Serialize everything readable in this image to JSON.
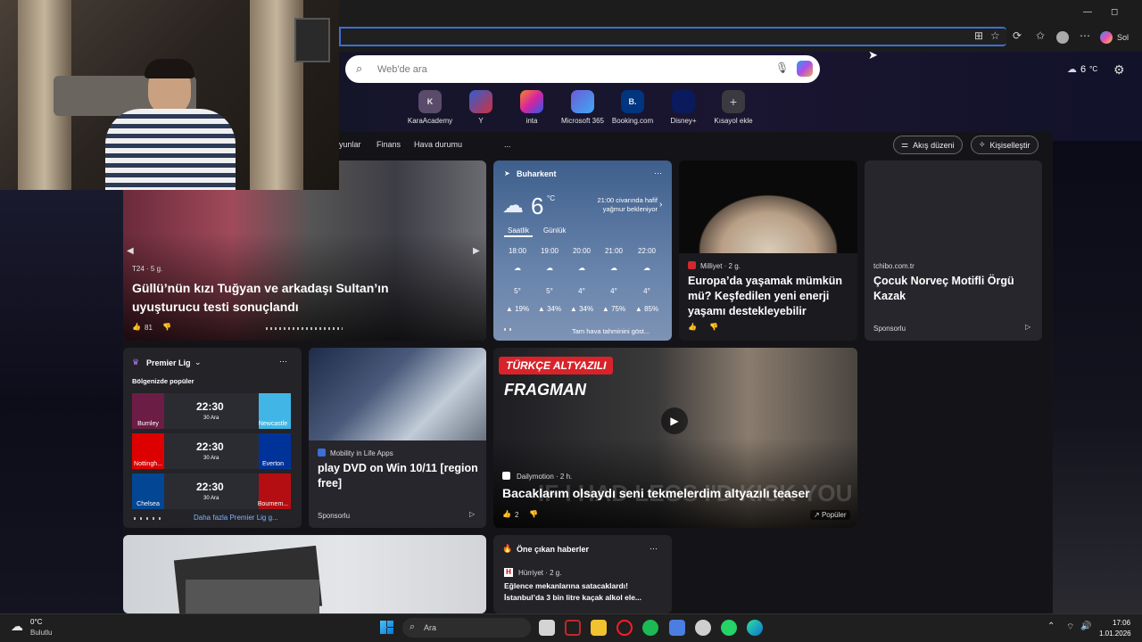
{
  "browser": {
    "profile_label": "Sol",
    "window_buttons": [
      "—",
      "◻"
    ]
  },
  "ntp": {
    "search_placeholder": "Web'de ara",
    "weather_temp": "6",
    "weather_unit": "°C",
    "quick_links": [
      {
        "label": "KaraAcademy",
        "initial": "K",
        "color": "#5a4b6a"
      },
      {
        "label": "Y",
        "initial": "",
        "color": "#2f5fd0"
      },
      {
        "label": "inta",
        "initial": "",
        "color": "#d6249f"
      },
      {
        "label": "Microsoft 365",
        "initial": "",
        "color": "#6b5bd6"
      },
      {
        "label": "Booking.com",
        "initial": "B.",
        "color": "#003580"
      },
      {
        "label": "Disney+",
        "initial": "",
        "color": "#0a1a5c"
      },
      {
        "label": "Kısayol ekle",
        "initial": "+",
        "color": "#3a3a40"
      }
    ],
    "nav": [
      "yunlar",
      "Finans",
      "Hava durumu",
      "..."
    ],
    "feed_layout_label": "Akış düzeni",
    "personalize_label": "Kişiselleştir"
  },
  "cards": {
    "hero": {
      "source": "T24 · 5 g.",
      "title": "Güllü’nün kızı Tuğyan ve arkadaşı Sultan’ın uyuşturucu testi sonuçlandı",
      "likes": "81"
    },
    "weather": {
      "location": "Buharkent",
      "temp": "6",
      "unit": "°C",
      "forecast_note": "21:00 civarında hafif yağmur bekleniyor",
      "tab_hourly": "Saatlik",
      "tab_daily": "Günlük",
      "hours": [
        "18:00",
        "19:00",
        "20:00",
        "21:00",
        "22:00"
      ],
      "temps": [
        "5°",
        "5°",
        "4°",
        "4°",
        "4°"
      ],
      "precip": [
        "19%",
        "34%",
        "34%",
        "75%",
        "85%"
      ],
      "full_link": "Tam hava tahminini göst..."
    },
    "europa": {
      "source": "Milliyet · 2 g.",
      "title": "Europa’da yaşamak mümkün mü? Keşfedilen yeni enerji yaşamı destekleyebilir"
    },
    "tchibo": {
      "source": "tchibo.com.tr",
      "title": "Çocuk Norveç Motifli Örgü Kazak",
      "sponsored": "Sponsorlu"
    },
    "league": {
      "title": "Premier Lig",
      "subtitle": "Bölgenizde popüler",
      "more": "Daha fazla Premier Lig g...",
      "matches": [
        {
          "home": "Burnley",
          "away": "Newcastle",
          "time": "22:30",
          "date": "30 Ara",
          "home_color": "#6c1d45",
          "away_color": "#41b6e6"
        },
        {
          "home": "Nottingh...",
          "away": "Everton",
          "time": "22:30",
          "date": "30 Ara",
          "home_color": "#dd0000",
          "away_color": "#003399"
        },
        {
          "home": "Chelsea",
          "away": "Bournem...",
          "time": "22:30",
          "date": "30 Ara",
          "home_color": "#034694",
          "away_color": "#b50e12"
        }
      ]
    },
    "dvd": {
      "source": "Mobility in Life Apps",
      "title": "play DVD on Win 10/11 [region free]",
      "sponsored": "Sponsorlu"
    },
    "video": {
      "badge": "TÜRKÇE ALTYAZILI",
      "headline": "FRAGMAN",
      "source": "Dailymotion · 2 h.",
      "title": "Bacaklarım olsaydı seni tekmelerdim altyazılı teaser",
      "likes": "2",
      "popular": "Popüler",
      "overlay": "IF I HAD LEGS I'D KICK YOU"
    },
    "news": {
      "header": "Öne çıkan haberler",
      "source": "Hürriyet · 2 g.",
      "line1": "Eğlence mekanlarına satacaklardı!",
      "line2": "İstanbul’da 3 bin litre kaçak alkol ele..."
    }
  },
  "taskbar": {
    "weather_temp": "0°C",
    "weather_desc": "Bulutlu",
    "search_label": "Ara",
    "time": "17:06",
    "date": "1.01.2026"
  }
}
